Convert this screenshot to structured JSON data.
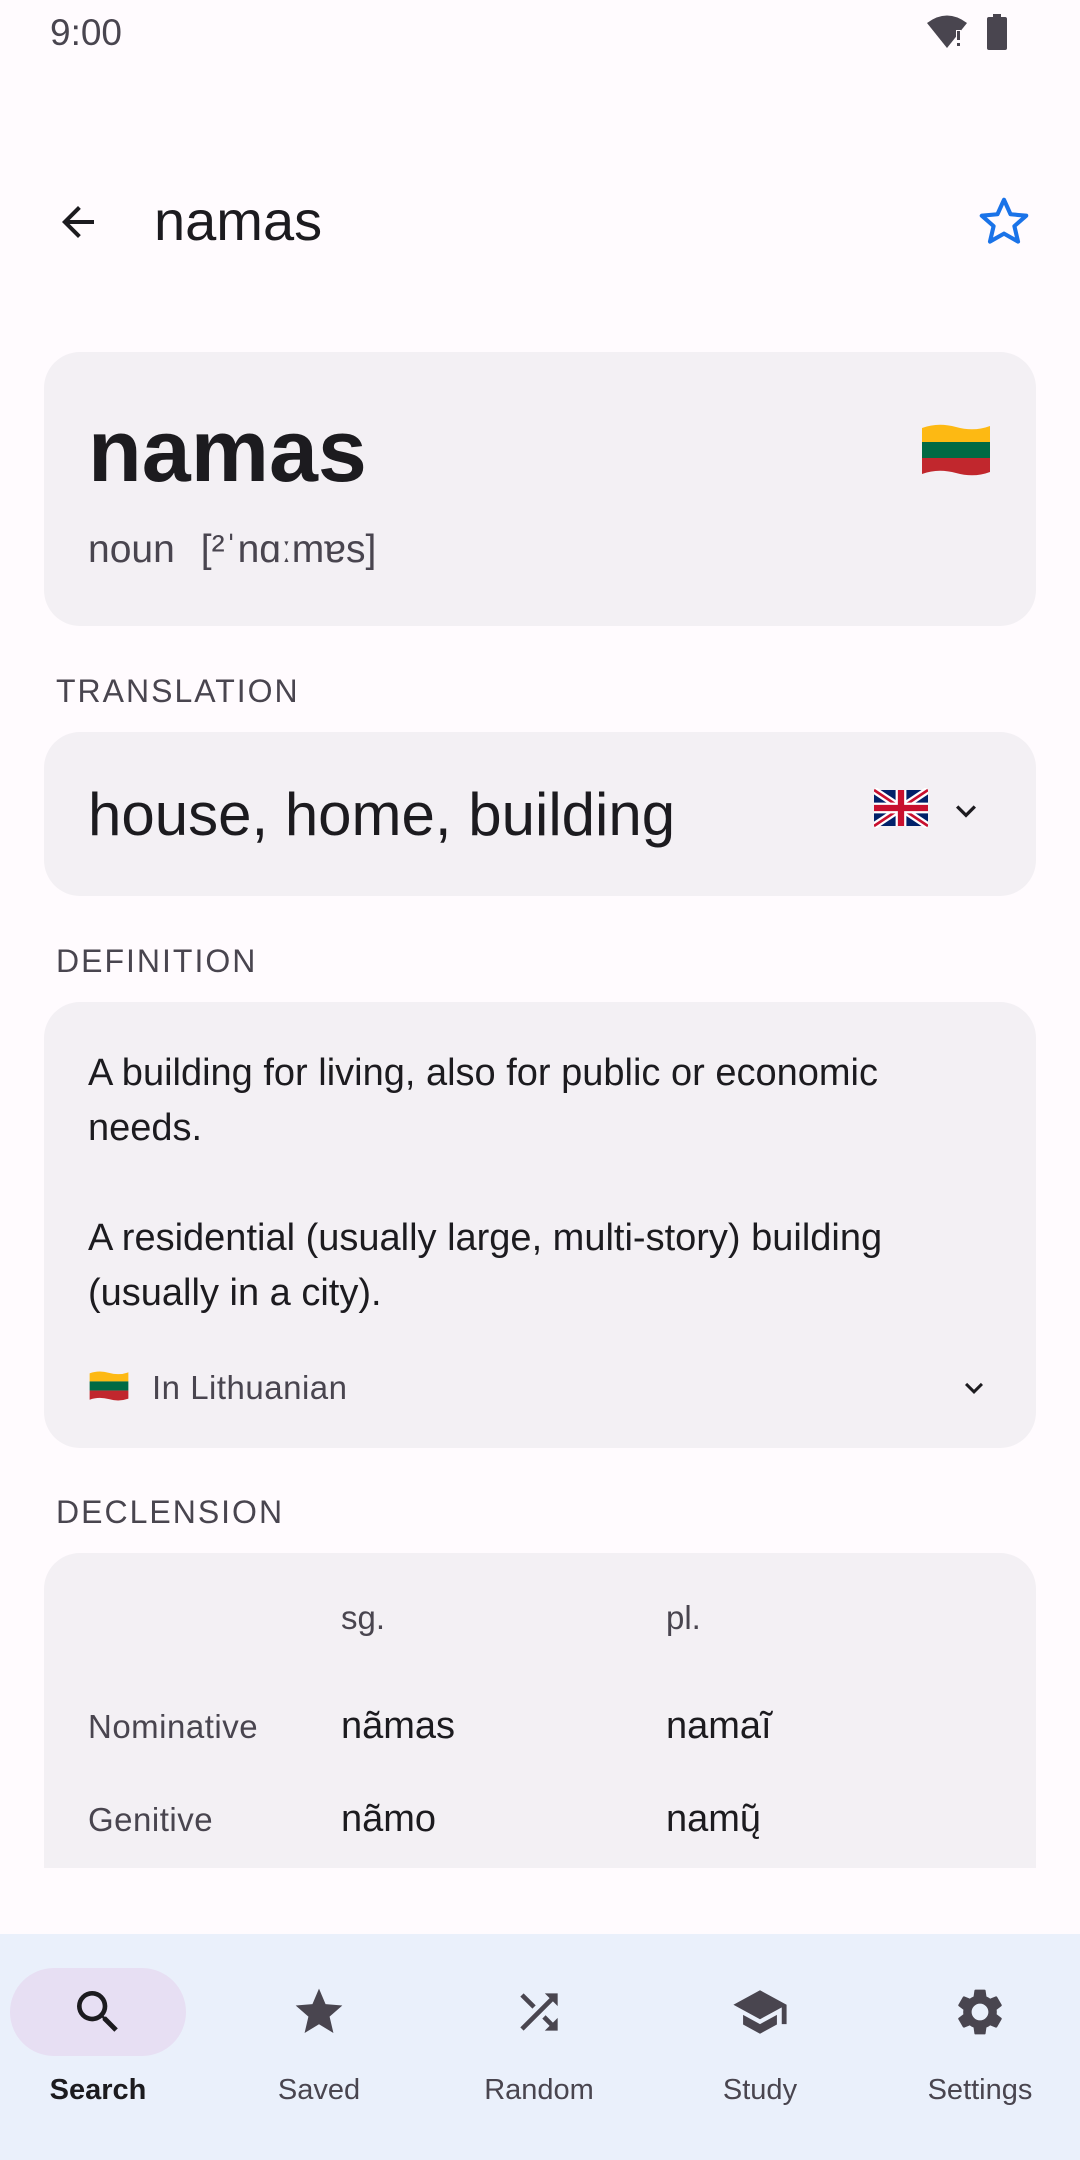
{
  "status_bar": {
    "time": "9:00"
  },
  "app_bar": {
    "title": "namas",
    "accent_color": "#1a73e8"
  },
  "entry": {
    "headword": "namas",
    "part_of_speech": "noun",
    "pronunciation": "[²ˈnɑːmɐs]",
    "flag": "lithuania-flag-icon"
  },
  "translation": {
    "label": "TRANSLATION",
    "text": "house, home, building",
    "language_flag": "uk-flag-icon"
  },
  "definition": {
    "label": "DEFINITION",
    "items": [
      "A building for living, also for public or economic needs.",
      "A residential (usually large, multi-story) building (usually in a city)."
    ],
    "in_language": "In Lithuanian"
  },
  "declension": {
    "label": "DECLENSION",
    "headers": {
      "singular": "sg.",
      "plural": "pl."
    },
    "rows": [
      {
        "case": "Nominative",
        "sg": "nãmas",
        "pl": "namaĩ"
      },
      {
        "case": "Genitive",
        "sg": "nãmo",
        "pl": "namų̃"
      }
    ]
  },
  "bottom_nav": {
    "items": [
      {
        "label": "Search",
        "icon": "search-icon",
        "active": true
      },
      {
        "label": "Saved",
        "icon": "star-icon",
        "active": false
      },
      {
        "label": "Random",
        "icon": "shuffle-icon",
        "active": false
      },
      {
        "label": "Study",
        "icon": "graduation-cap-icon",
        "active": false
      },
      {
        "label": "Settings",
        "icon": "gear-icon",
        "active": false
      }
    ]
  }
}
